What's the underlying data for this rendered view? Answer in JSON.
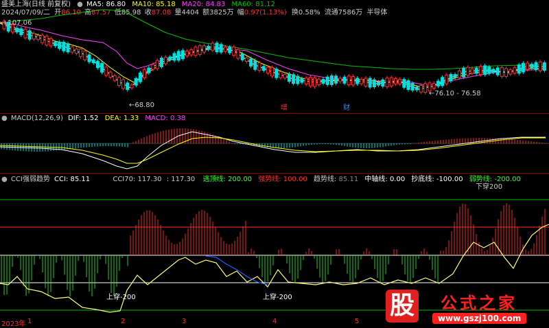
{
  "header": {
    "name": "盛美上海(日线 前复权)",
    "ma5_label": "MA5:",
    "ma5": "86.80",
    "ma10_label": "MA10:",
    "ma10": "85.18",
    "ma20_label": "MA20:",
    "ma20": "84.83",
    "ma60_label": "MA60:",
    "ma60": "81.12"
  },
  "quote": {
    "date": "2024/07/09/二",
    "open_label": "开",
    "open": "86.10",
    "high_label": "高",
    "high": "87.57",
    "low_label": "低",
    "low": "85.98",
    "close_label": "收",
    "close": "87.08",
    "volume_label": "量",
    "volume": "4404",
    "amount_label": "额",
    "amount": "3825万",
    "change_label": "幅",
    "change": "0.97(1.13%)",
    "turnover_label": "换",
    "turnover": "0.58%",
    "float_label": "流通",
    "float": "7586万",
    "sector": "半导体"
  },
  "price_annotations": {
    "high_marker": "107.06",
    "low_marker": "68.80",
    "range_marker": "76.10 - 76.58",
    "tag_zeng": "增",
    "tag_cai": "财"
  },
  "macd": {
    "label": "MACD(12,26,9)",
    "dif_label": "DIF:",
    "dif": "1.52",
    "dea_label": "DEA:",
    "dea": "1.33",
    "macd_label": "MACD:",
    "macd": "0.38"
  },
  "cci": {
    "label": "CCI强弱趋势",
    "cci_label": "CCI:",
    "cci": "85.11",
    "cci70_label": "CCI70:",
    "cci70": "117.30",
    "cci70_b": "117.30",
    "top_label": "逃顶线:",
    "top": "200.00",
    "strong_label": "强势线:",
    "strong": "100.00",
    "trend_label": "趋势线:",
    "trend": "85.11",
    "mid_label": "中轴线:",
    "mid": "0.00",
    "bottom_label": "抄底线:",
    "bottom": "-100.00",
    "weak_label": "弱势线:",
    "weak": "-200.00",
    "ann_up200_a": "上穿-200",
    "ann_up200_b": "上穿-200",
    "ann_down200": "下穿200"
  },
  "xaxis": {
    "year": "2023年",
    "m1": "1",
    "m2": "2",
    "m3": "3",
    "m4": "4",
    "m5": "5"
  },
  "watermark": {
    "logo_char": "股",
    "title": "公式之家",
    "url": "www.gszj100.com"
  },
  "colors": {
    "up": "#ff3030",
    "down": "#00e0e0",
    "ma5": "#ffffff",
    "ma10": "#ffff00",
    "ma20": "#ff40ff",
    "ma60": "#00c000",
    "divider": "#8b0000"
  }
}
